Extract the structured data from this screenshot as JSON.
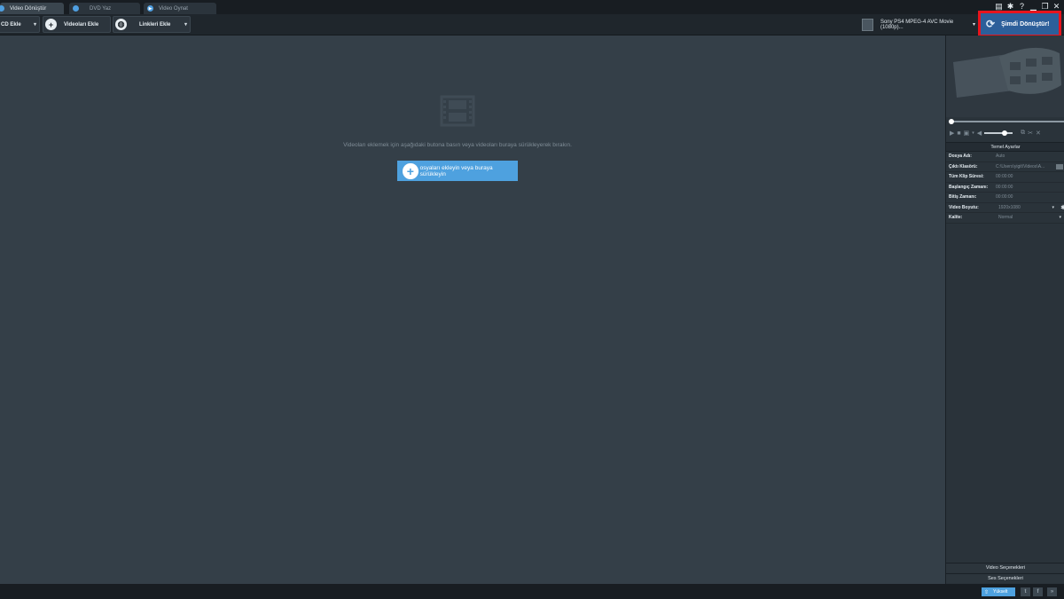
{
  "tabs": [
    {
      "label": "Video Dönüştür",
      "active": true
    },
    {
      "label": "DVD Yaz",
      "active": false
    },
    {
      "label": "Video Oynat",
      "active": false
    }
  ],
  "window_controls": {
    "icons": [
      "register-icon",
      "settings-icon",
      "help-icon",
      "minimize-icon",
      "restore-icon",
      "close-icon"
    ],
    "help_label": "?",
    "close_label": "✕"
  },
  "toolbar": {
    "add_dvd_label": "CD Ekle",
    "add_videos_label": "Videoları Ekle",
    "add_links_label": "Linkleri Ekle",
    "output_profile": "Sony PS4 MPEG-4 AVC Movie (1080p)...",
    "convert_label": "Şimdi Dönüştür!"
  },
  "main": {
    "hint": "Videoları eklemek için aşağıdaki butona basın veya videoları buraya sürükleyerek bırakın.",
    "add_files_label": "osyaları ekleyin veya buraya sürükleyin"
  },
  "player": {
    "seek_progress": 0,
    "volume_level": 0.75
  },
  "settings": {
    "title": "Temel Ayarlar",
    "rows": [
      {
        "label": "Dosya Adı:",
        "value": "Auto"
      },
      {
        "label": "Çıktı Klasörü:",
        "value": "C:\\Users\\yigit\\Videos\\A..."
      },
      {
        "label": "Tüm Klip Süresi:",
        "value": "00:00:00"
      },
      {
        "label": "Başlangıç Zamanı:",
        "value": "00:00:00"
      },
      {
        "label": "Bitiş Zamanı:",
        "value": "00:00:00"
      },
      {
        "label": "Video Boyutu:",
        "value": "1920x1080"
      },
      {
        "label": "Kalite:",
        "value": "Normal"
      }
    ],
    "video_options_label": "Video Seçenekleri",
    "audio_options_label": "Ses Seçenekleri"
  },
  "statusbar": {
    "upgrade_label": "Yükselt",
    "twitter_glyph": "t",
    "facebook_glyph": "f",
    "more_glyph": "»"
  },
  "colors": {
    "accent": "#4ea1df",
    "highlight_border": "#e8141d",
    "background": "#343f48"
  }
}
